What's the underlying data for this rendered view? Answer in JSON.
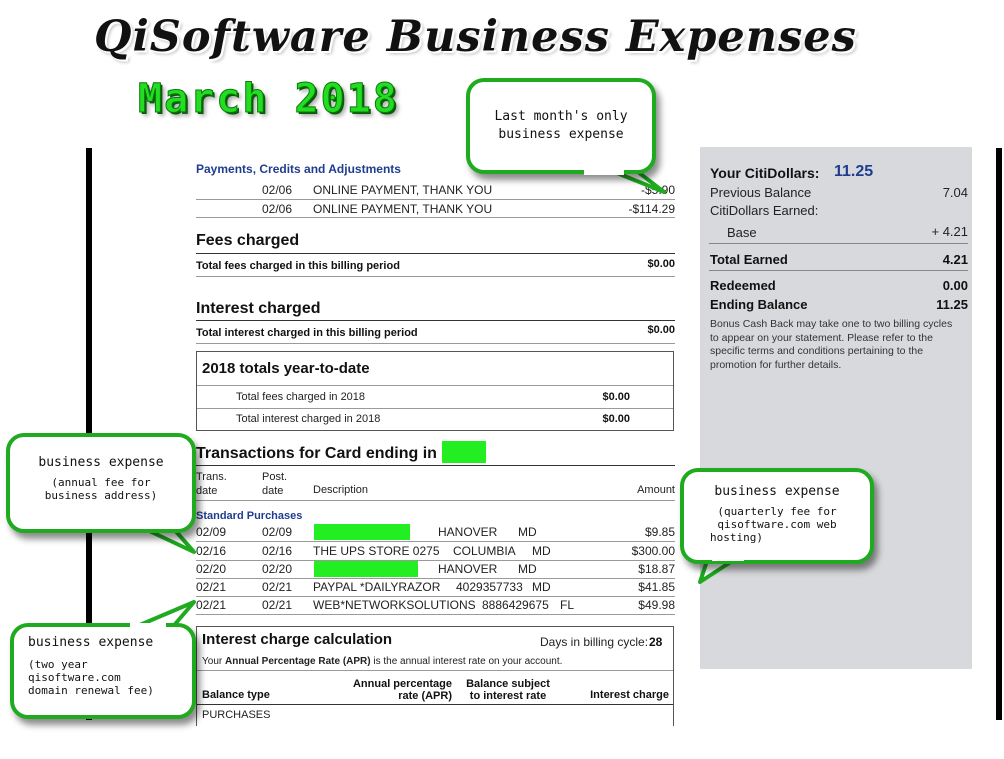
{
  "title": "QiSoftware Business Expenses",
  "month": "March 2018",
  "payments": {
    "heading": "Payments, Credits and Adjustments",
    "rows": [
      {
        "date": "02/06",
        "desc": "ONLINE PAYMENT, THANK YOU",
        "amount": "-$5.90"
      },
      {
        "date": "02/06",
        "desc": "ONLINE PAYMENT, THANK YOU",
        "amount": "-$114.29"
      }
    ]
  },
  "fees": {
    "heading": "Fees charged",
    "label": "Total fees charged in this billing period",
    "value": "$0.00"
  },
  "interest": {
    "heading": "Interest charged",
    "label": "Total interest charged in this billing period",
    "value": "$0.00"
  },
  "ytd": {
    "heading": "2018 totals year-to-date",
    "fees_label": "Total fees charged in 2018",
    "fees_value": "$0.00",
    "interest_label": "Total interest charged in 2018",
    "interest_value": "$0.00"
  },
  "transactions": {
    "heading": "Transactions for Card ending in",
    "col_trans1": "Trans.",
    "col_trans2": "date",
    "col_post1": "Post.",
    "col_post2": "date",
    "col_desc": "Description",
    "col_amount": "Amount",
    "section": "Standard Purchases",
    "rows": [
      {
        "trans": "02/09",
        "post": "02/09",
        "desc": "",
        "city": "HANOVER",
        "state": "MD",
        "amount": "$9.85"
      },
      {
        "trans": "02/16",
        "post": "02/16",
        "desc": "THE UPS STORE 0275",
        "city": "COLUMBIA",
        "state": "MD",
        "amount": "$300.00"
      },
      {
        "trans": "02/20",
        "post": "02/20",
        "desc": "",
        "city": "HANOVER",
        "state": "MD",
        "amount": "$18.87"
      },
      {
        "trans": "02/21",
        "post": "02/21",
        "desc": "PAYPAL *DAILYRAZOR",
        "city": "4029357733",
        "state": "MD",
        "amount": "$41.85"
      },
      {
        "trans": "02/21",
        "post": "02/21",
        "desc": "WEB*NETWORKSOLUTIONS",
        "city": "8886429675",
        "state": "FL",
        "amount": "$49.98"
      }
    ]
  },
  "calc": {
    "heading": "Interest charge calculation",
    "days_label": "Days in billing cycle:",
    "days_value": "28",
    "apr_pre": "Your",
    "apr_bold": "Annual Percentage Rate (APR)",
    "apr_post": "is the annual interest rate on your account.",
    "col_balance": "Balance type",
    "col_apr1": "Annual percentage",
    "col_apr2": "rate (APR)",
    "col_subject1": "Balance subject",
    "col_subject2": "to interest rate",
    "col_charge": "Interest charge",
    "first_row": "PURCHASES"
  },
  "citidollars": {
    "label": "Your CitiDollars:",
    "value": "11.25",
    "prev_label": "Previous Balance",
    "prev_value": "7.04",
    "earned_label": "CitiDollars Earned:",
    "base_label": "Base",
    "base_value": "+ 4.21",
    "total_label": "Total Earned",
    "total_value": "4.21",
    "redeemed_label": "Redeemed",
    "redeemed_value": "0.00",
    "ending_label": "Ending Balance",
    "ending_value": "11.25",
    "note": "Bonus Cash Back may take one to two billing cycles to appear on your statement. Please refer to the specific terms and conditions pertaining to the promotion for further details."
  },
  "bubbles": {
    "top_line1": "Last month's only",
    "top_line2": "business expense",
    "left1_title": "business expense",
    "left1_sub1": "(annual fee for",
    "left1_sub2": "business address)",
    "right_title": "business expense",
    "right_sub1": "(quarterly fee for",
    "right_sub2": "qisoftware.com web",
    "right_sub3": "hosting)",
    "left2_title": "business expense",
    "left2_sub1": "(two year",
    "left2_sub2": "qisoftware.com",
    "left2_sub3": "domain renewal fee)"
  },
  "colors": {
    "accent_green": "#22ee22",
    "bubble_border": "#1faa1f",
    "citi_blue": "#1f3d8f",
    "sidebar_bg": "#d7d9dc"
  }
}
